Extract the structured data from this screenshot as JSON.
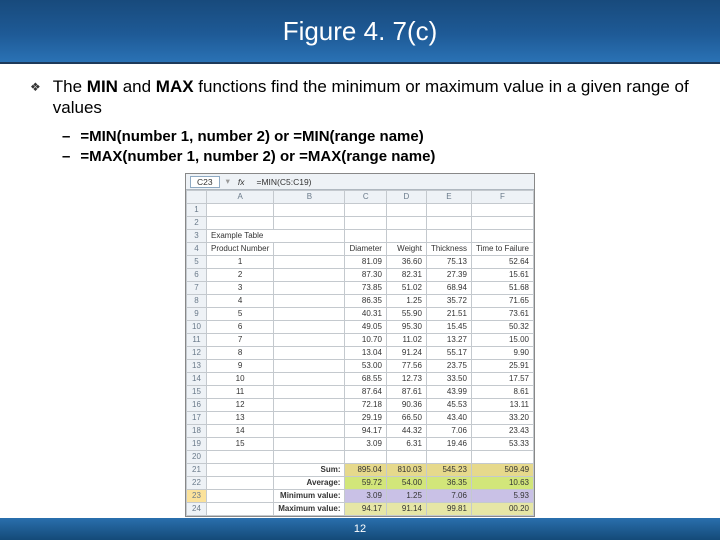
{
  "title": "Figure 4. 7(c)",
  "bullet_pre": "The ",
  "bullet_b1": "MIN",
  "bullet_mid": " and ",
  "bullet_b2": "MAX",
  "bullet_post": " functions find the minimum or maximum value in a given range of values",
  "dash1": "=MIN(number 1, number 2)   or   =MIN(range name)",
  "dash2": "=MAX(number 1, number 2)   or   =MAX(range name)",
  "slide_number": "12",
  "formula_bar": {
    "cell": "C23",
    "fx": "fx",
    "formula": "=MIN(C5:C19)"
  },
  "cols": [
    "",
    "A",
    "B",
    "C",
    "D",
    "E",
    "F"
  ],
  "example_label": "Example Table",
  "headers": {
    "a": "Product Number",
    "b": "Diameter",
    "c": "Weight",
    "d": "Thickness",
    "e": "Time to Failure"
  },
  "rows": [
    {
      "n": "5",
      "p": "1",
      "d": "81.09",
      "w": "36.60",
      "t": "75.13",
      "f": "52.64"
    },
    {
      "n": "6",
      "p": "2",
      "d": "87.30",
      "w": "82.31",
      "t": "27.39",
      "f": "15.61"
    },
    {
      "n": "7",
      "p": "3",
      "d": "73.85",
      "w": "51.02",
      "t": "68.94",
      "f": "51.68"
    },
    {
      "n": "8",
      "p": "4",
      "d": "86.35",
      "w": "1.25",
      "t": "35.72",
      "f": "71.65"
    },
    {
      "n": "9",
      "p": "5",
      "d": "40.31",
      "w": "55.90",
      "t": "21.51",
      "f": "73.61"
    },
    {
      "n": "10",
      "p": "6",
      "d": "49.05",
      "w": "95.30",
      "t": "15.45",
      "f": "50.32"
    },
    {
      "n": "11",
      "p": "7",
      "d": "10.70",
      "w": "11.02",
      "t": "13.27",
      "f": "15.00"
    },
    {
      "n": "12",
      "p": "8",
      "d": "13.04",
      "w": "91.24",
      "t": "55.17",
      "f": "9.90"
    },
    {
      "n": "13",
      "p": "9",
      "d": "53.00",
      "w": "77.56",
      "t": "23.75",
      "f": "25.91"
    },
    {
      "n": "14",
      "p": "10",
      "d": "68.55",
      "w": "12.73",
      "t": "33.50",
      "f": "17.57"
    },
    {
      "n": "15",
      "p": "11",
      "d": "87.64",
      "w": "87.61",
      "t": "43.99",
      "f": "8.61"
    },
    {
      "n": "16",
      "p": "12",
      "d": "72.18",
      "w": "90.36",
      "t": "45.53",
      "f": "13.11"
    },
    {
      "n": "17",
      "p": "13",
      "d": "29.19",
      "w": "66.50",
      "t": "43.40",
      "f": "33.20"
    },
    {
      "n": "18",
      "p": "14",
      "d": "94.17",
      "w": "44.32",
      "t": "7.06",
      "f": "23.43"
    },
    {
      "n": "19",
      "p": "15",
      "d": "3.09",
      "w": "6.31",
      "t": "19.46",
      "f": "53.33"
    }
  ],
  "blankrow": "20",
  "summary": [
    {
      "n": "21",
      "lab": "Sum:",
      "c": "895.04",
      "d": "810.03",
      "e": "545.23",
      "f": "509.49",
      "cls": "sum-row"
    },
    {
      "n": "22",
      "lab": "Average:",
      "c": "59.72",
      "d": "54.00",
      "e": "36.35",
      "f": "10.63",
      "cls": "avg-row"
    },
    {
      "n": "23",
      "lab": "Minimum value:",
      "c": "3.09",
      "d": "1.25",
      "e": "7.06",
      "f": "5.93",
      "cls": "min-row"
    },
    {
      "n": "24",
      "lab": "Maximum value:",
      "c": "94.17",
      "d": "91.14",
      "e": "99.81",
      "f": "00.20",
      "cls": "max-row"
    }
  ]
}
